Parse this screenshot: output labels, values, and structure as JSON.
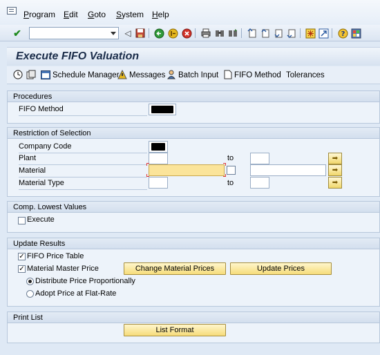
{
  "menu": {
    "items": [
      {
        "label_u": "P",
        "label_rest": "rogram"
      },
      {
        "label_u": "E",
        "label_rest": "dit"
      },
      {
        "label_u": "G",
        "label_rest": "oto"
      },
      {
        "label_u": "S",
        "label_rest": "ystem"
      },
      {
        "label_u": "H",
        "label_rest": "elp"
      }
    ]
  },
  "toolbar": {
    "command_field_value": ""
  },
  "title": "Execute FIFO Valuation",
  "app_toolbar": {
    "schedule_manager": "Schedule Manager",
    "messages": "Messages",
    "batch_input": "Batch Input",
    "fifo_method": "FIFO Method",
    "tolerances": "Tolerances"
  },
  "procedures": {
    "header": "Procedures",
    "fifo_method_label": "FIFO Method"
  },
  "restriction": {
    "header": "Restriction of Selection",
    "company_code_label": "Company Code",
    "plant_label": "Plant",
    "material_label": "Material",
    "material_type_label": "Material Type",
    "to_label": "to"
  },
  "lowest_values": {
    "header": "Comp. Lowest Values",
    "execute_label": "Execute",
    "execute_checked": false
  },
  "update_results": {
    "header": "Update Results",
    "fifo_price_table_label": "FIFO Price Table",
    "fifo_price_table_checked": true,
    "material_master_price_label": "Material Master Price",
    "material_master_price_checked": true,
    "change_material_prices_button": "Change Material Prices",
    "update_prices_button": "Update Prices",
    "distribute_label": "Distribute Price Proportionally",
    "distribute_selected": true,
    "adopt_label": "Adopt Price at Flat-Rate",
    "adopt_selected": false
  },
  "print_list": {
    "header": "Print List",
    "list_format_button": "List Format"
  },
  "check_glyph": "✓"
}
